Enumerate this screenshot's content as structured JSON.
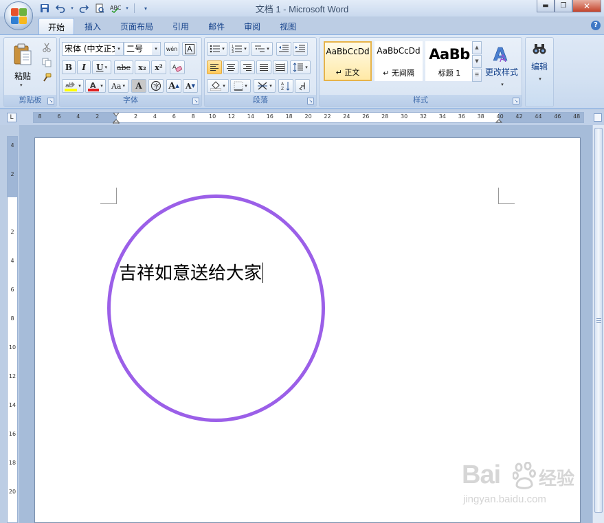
{
  "window": {
    "title": "文档 1 - Microsoft Word",
    "minimize_icon": "minimize-icon",
    "maximize_icon": "restore-icon",
    "close_icon": "close-icon"
  },
  "qat": [
    "save-icon",
    "undo-icon",
    "redo-icon",
    "print-preview-icon",
    "spelling-icon",
    "customize-qat-icon"
  ],
  "tabs": [
    {
      "label": "开始",
      "active": true
    },
    {
      "label": "插入"
    },
    {
      "label": "页面布局"
    },
    {
      "label": "引用"
    },
    {
      "label": "邮件"
    },
    {
      "label": "审阅"
    },
    {
      "label": "视图"
    }
  ],
  "ribbon": {
    "clipboard": {
      "label": "剪贴板",
      "paste": "粘贴"
    },
    "font": {
      "label": "字体",
      "font_name": "宋体 (中文正文)",
      "font_size": "二号",
      "bold": "B",
      "italic": "I",
      "underline": "U",
      "strikethrough": "abe",
      "subscript": "x₂",
      "superscript": "x²",
      "change_case": "Aa",
      "grow_font": "A",
      "shrink_font": "A",
      "char_shading": "A",
      "phonetic": "wén"
    },
    "paragraph": {
      "label": "段落"
    },
    "styles": {
      "label": "样式",
      "tiles": [
        {
          "sample": "AaBbCcDd",
          "name": "↵ 正文",
          "selected": true
        },
        {
          "sample": "AaBbCcDd",
          "name": "↵ 无间隔"
        },
        {
          "sample": "AaBb",
          "name": "标题 1"
        }
      ],
      "change_styles": "更改样式"
    },
    "editing": {
      "label": "编辑"
    }
  },
  "ruler": {
    "h_ticks": [
      "8",
      "6",
      "4",
      "2",
      "",
      "2",
      "4",
      "6",
      "8",
      "10",
      "12",
      "14",
      "16",
      "18",
      "20",
      "22",
      "24",
      "26",
      "28",
      "30",
      "32",
      "34",
      "36",
      "38",
      "40",
      "42",
      "44",
      "46",
      "48"
    ],
    "v_ticks": [
      "4",
      "2",
      "",
      "2",
      "4",
      "6",
      "8",
      "10",
      "12",
      "14",
      "16",
      "18",
      "20"
    ]
  },
  "document": {
    "text": "吉祥如意送给大家",
    "shape_color": "#9b5fe8"
  },
  "watermark": {
    "brand": "Bai",
    "brand_tail": "经验",
    "url": "jingyan.baidu.com"
  },
  "colors": {
    "accent": "#15428b",
    "highlight": "#ffc95c",
    "circle": "#9b5fe8"
  }
}
